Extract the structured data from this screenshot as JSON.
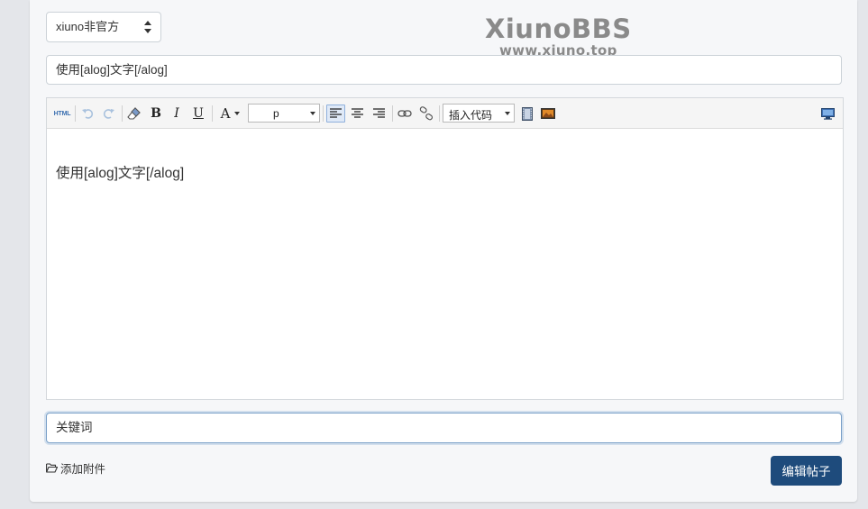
{
  "forum_select": {
    "selected": "xiuno非官方"
  },
  "watermark": {
    "brand": "XiunoBBS",
    "url": "www.xiuno.top"
  },
  "title_input": {
    "value": "使用[alog]文字[/alog]"
  },
  "editor": {
    "toolbar": {
      "html_label": "HTML",
      "bold_label": "B",
      "italic_label": "I",
      "underline_label": "U",
      "font_color_label": "A",
      "paragraph_value": "p",
      "insert_code_value": "插入代码"
    },
    "content": "使用[alog]文字[/alog]"
  },
  "keywords_input": {
    "value": "关键词"
  },
  "attach_label": "添加附件",
  "submit_label": "编辑帖子",
  "colors": {
    "primary_button": "#1e4b7c",
    "focus_border": "#7aa0c8",
    "toolbar_bg": "#f5f5f5",
    "page_bg": "#e4e6ea"
  }
}
